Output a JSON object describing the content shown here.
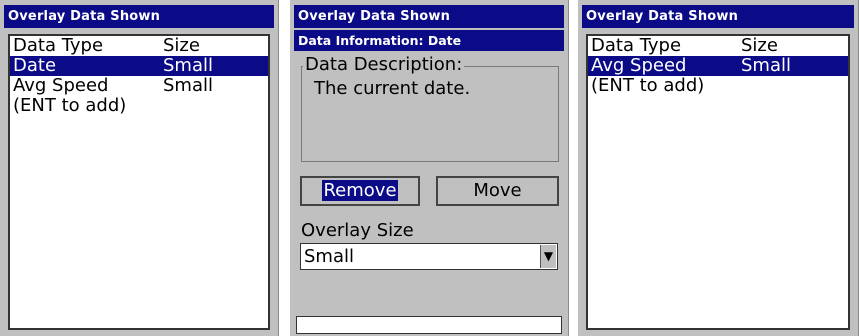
{
  "left": {
    "title": "Overlay Data Shown",
    "header": {
      "type": "Data Type",
      "size": "Size"
    },
    "rows": [
      {
        "type": "Date",
        "size": "Small"
      },
      {
        "type": "Avg Speed",
        "size": "Small"
      },
      {
        "type": "(ENT to add)",
        "size": ""
      }
    ]
  },
  "middle": {
    "title": "Overlay Data Shown",
    "dialog_title": "Data Information: Date",
    "group_label": "Data Description:",
    "description": "The current date.",
    "remove_label": "Remove",
    "move_label": "Move",
    "size_label": "Overlay Size",
    "size_value": "Small"
  },
  "right": {
    "title": "Overlay Data Shown",
    "header": {
      "type": "Data Type",
      "size": "Size"
    },
    "rows": [
      {
        "type": "Avg Speed",
        "size": "Small"
      },
      {
        "type": "(ENT to add)",
        "size": ""
      }
    ]
  }
}
